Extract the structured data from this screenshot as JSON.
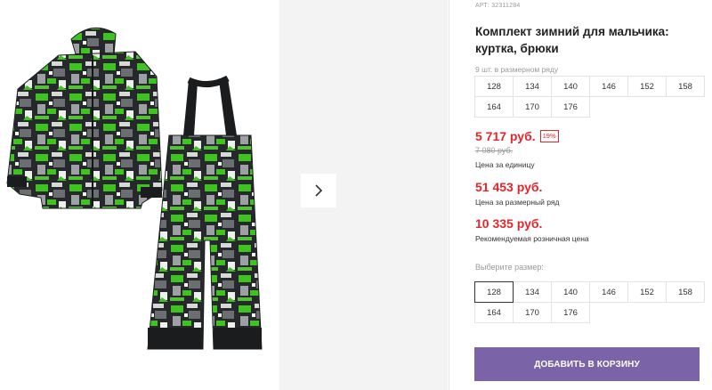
{
  "product": {
    "sku_label": "АРТ: 32311284",
    "title": "Комплект зимний для мальчика: куртка, брюки"
  },
  "gallery": {
    "image_description_icon": "kids-winter-suit-photo",
    "next_icon": "chevron-right-icon"
  },
  "pack": {
    "label": "9 шт. в размерном ряду",
    "sizes": [
      "128",
      "134",
      "140",
      "146",
      "152",
      "158",
      "164",
      "170",
      "176"
    ]
  },
  "pricing": {
    "unit_price": "5 717 руб.",
    "discount": "19%",
    "old_price": "7 080 руб.",
    "unit_label": "Цена за единицу",
    "pack_price": "51 453 руб.",
    "pack_label": "Цена за размерный ряд",
    "retail_price": "10 335 руб.",
    "retail_label": "Рекомендуемая розничная цена"
  },
  "size_select": {
    "label": "Выберите размер:",
    "sizes": [
      "128",
      "134",
      "140",
      "146",
      "152",
      "158",
      "164",
      "170",
      "176"
    ],
    "selected": "128"
  },
  "cart": {
    "button_label": "ДОБАВИТЬ В КОРЗИНУ"
  },
  "colors": {
    "price_red": "#e3262a",
    "accent_purple": "#7b63a8",
    "print_green": "#3ec41e"
  }
}
